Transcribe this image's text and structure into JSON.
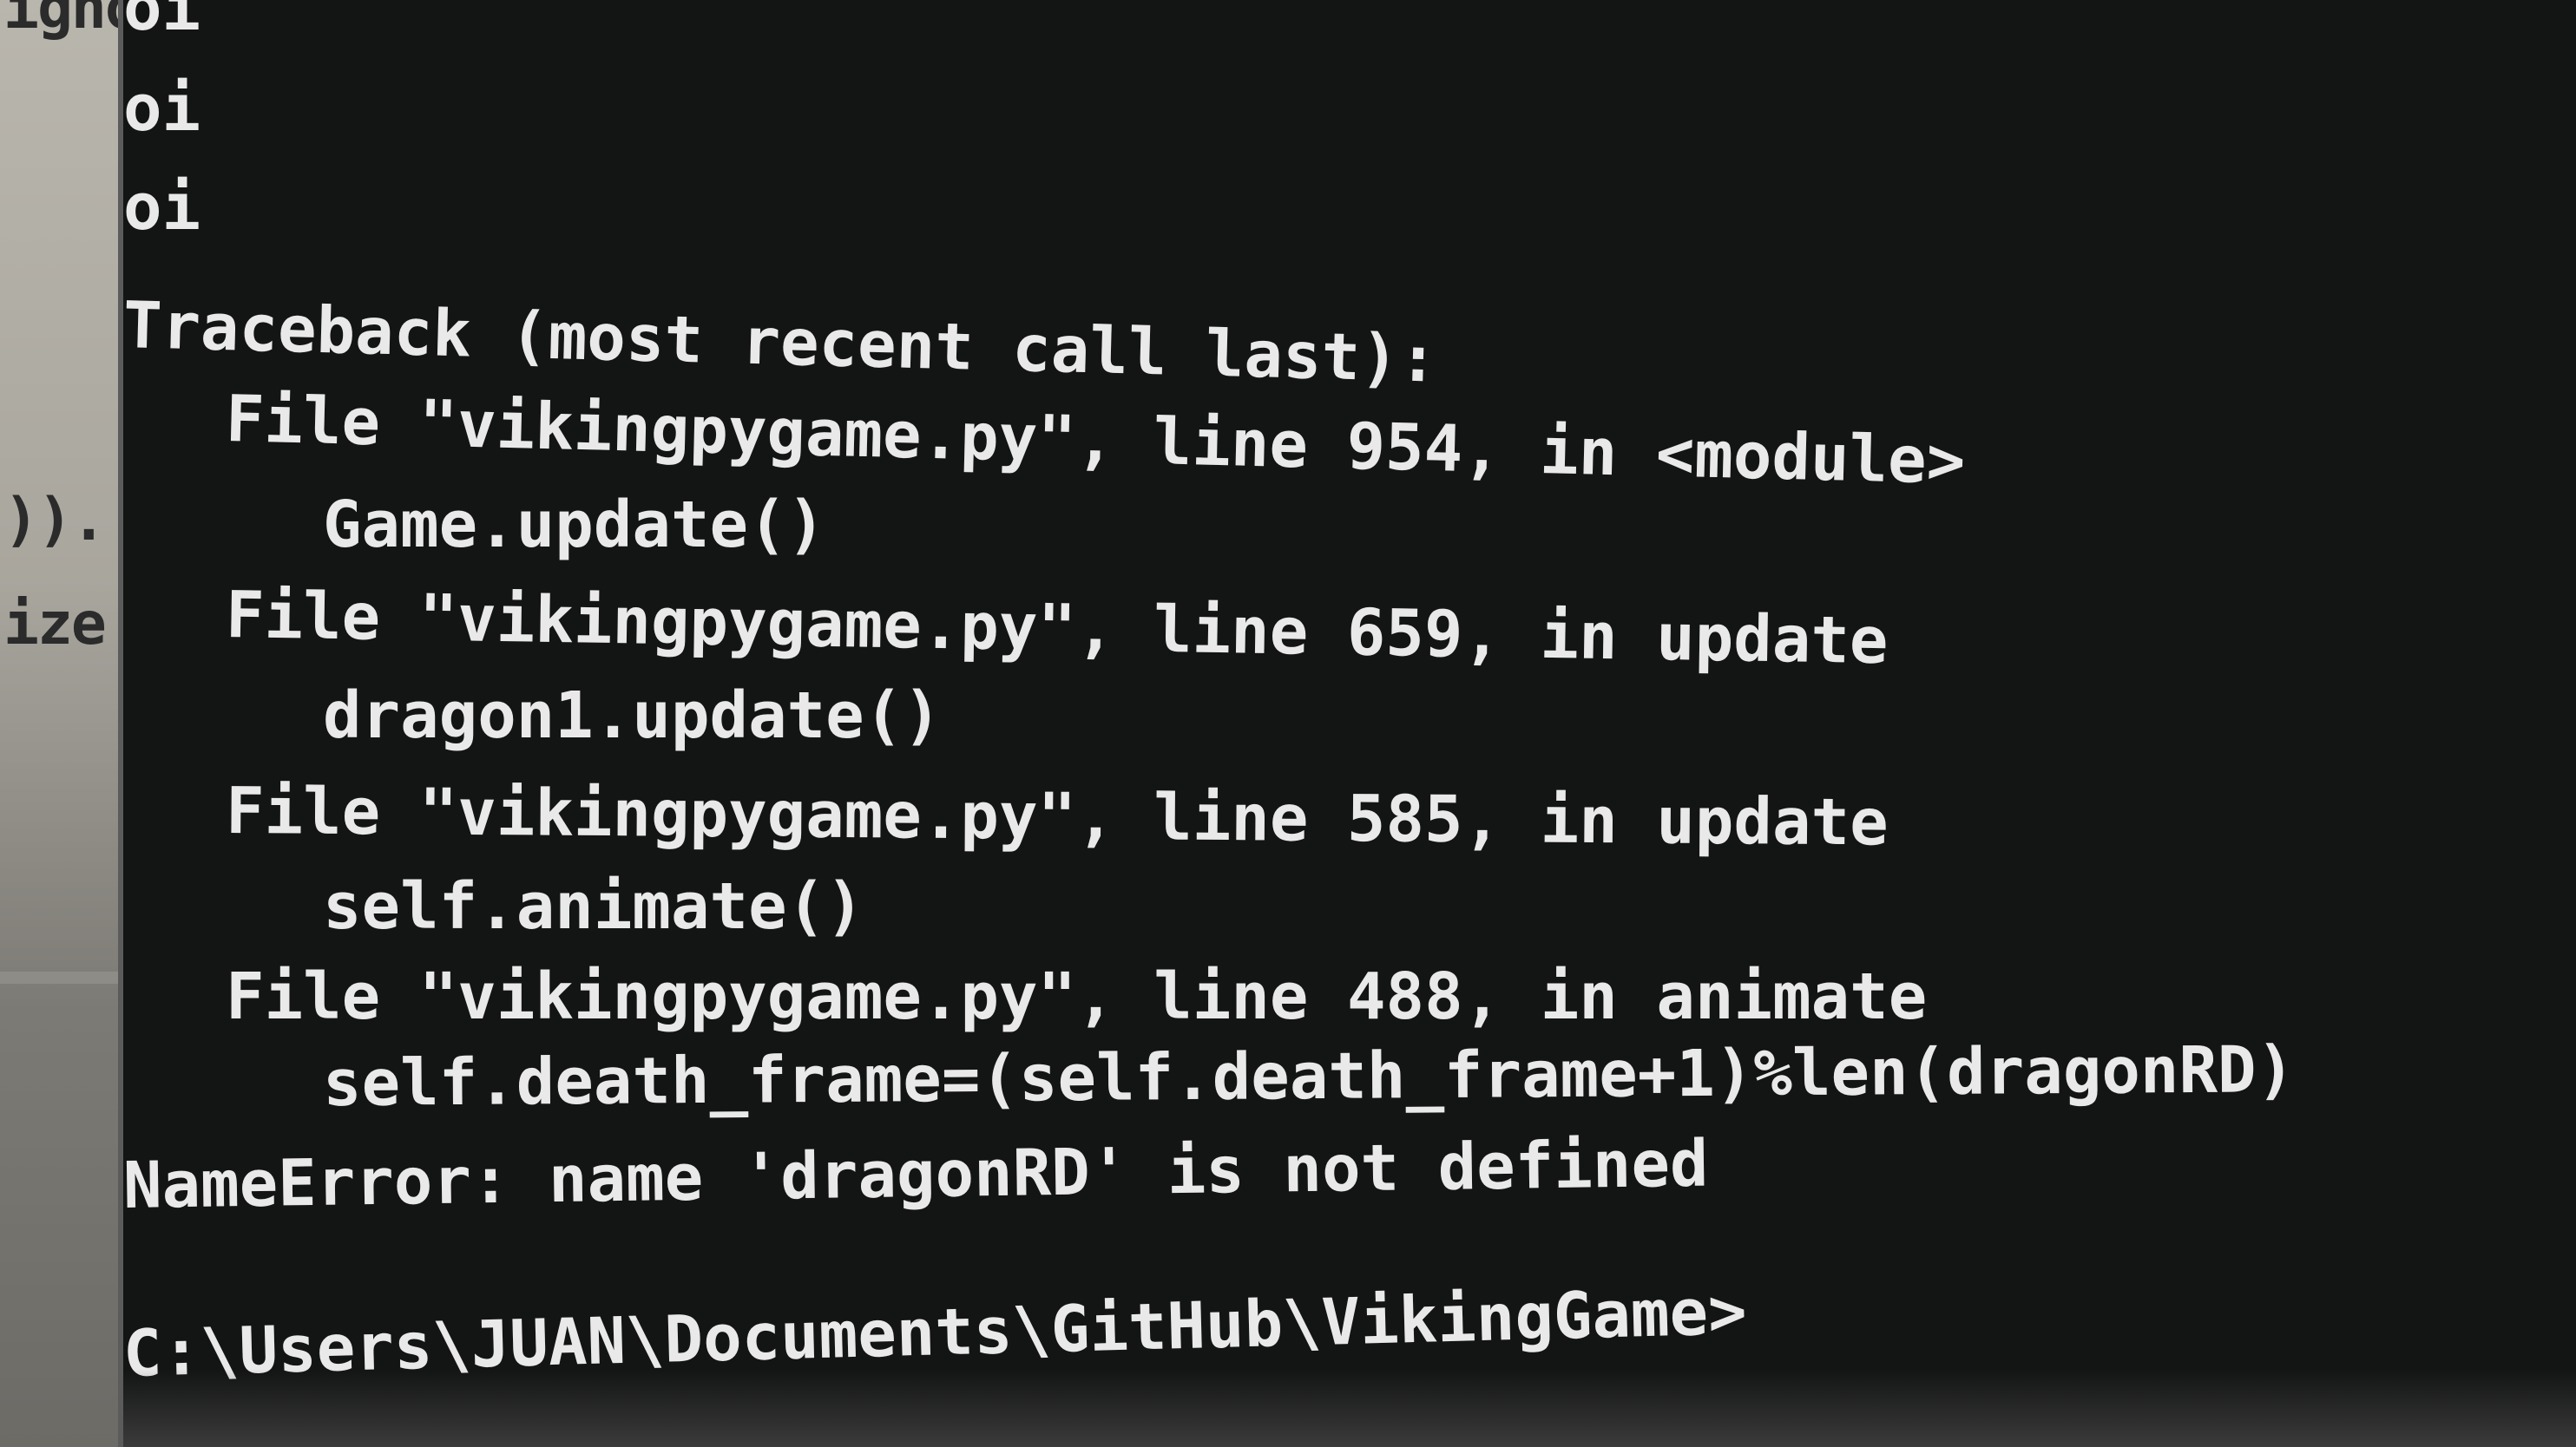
{
  "background_window": {
    "visible_fragments": [
      "ignoi",
      ")).",
      "ize"
    ]
  },
  "console": {
    "lines": [
      "oi",
      "oi",
      "oi",
      "Traceback (most recent call last):",
      "File \"vikingpygame.py\", line 954, in <module>",
      "Game.update()",
      "File \"vikingpygame.py\", line 659, in update",
      "dragon1.update()",
      "File \"vikingpygame.py\", line 585, in update",
      "self.animate()",
      "File \"vikingpygame.py\", line 488, in animate",
      "self.death_frame=(self.death_frame+1)%len(dragonRD)",
      "NameError: name 'dragonRD' is not defined",
      "C:\\Users\\JUAN\\Documents\\GitHub\\VikingGame>"
    ]
  },
  "colors": {
    "console_background": "#131414",
    "console_text": "#e9e9e9",
    "editor_background": "#b9b6ad"
  }
}
